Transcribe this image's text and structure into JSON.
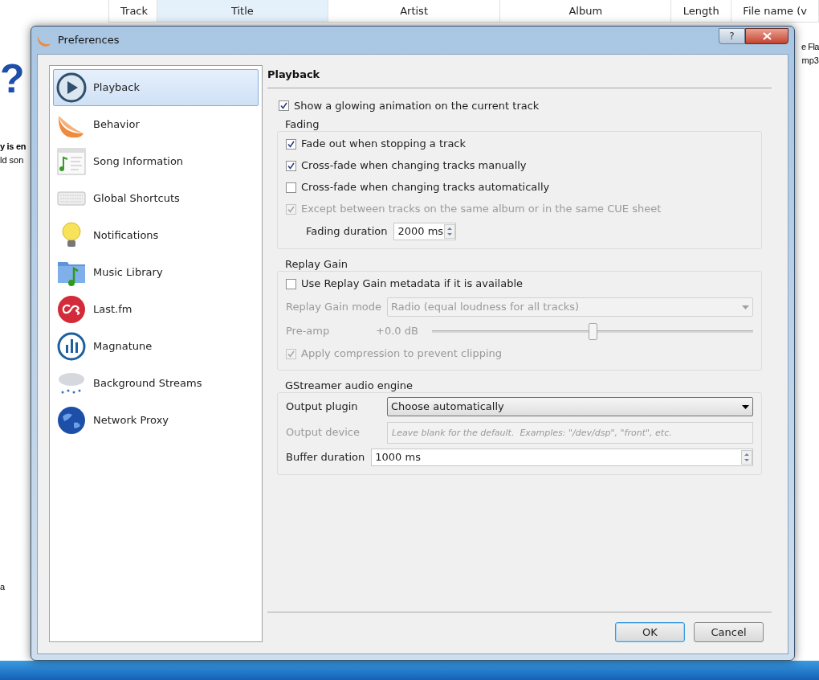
{
  "background_window": {
    "columns": [
      "Track",
      "Title",
      "Artist",
      "Album",
      "Length",
      "File name (v"
    ],
    "left_fragments": [
      "?",
      "y is en",
      "ld son",
      "a"
    ],
    "right_fragments": [
      "e Fla",
      "mp3"
    ]
  },
  "dialog": {
    "title": "Preferences",
    "help": "?",
    "sidebar": [
      {
        "label": "Playback",
        "selected": true
      },
      {
        "label": "Behavior",
        "selected": false
      },
      {
        "label": "Song Information",
        "selected": false
      },
      {
        "label": "Global Shortcuts",
        "selected": false
      },
      {
        "label": "Notifications",
        "selected": false
      },
      {
        "label": "Music Library",
        "selected": false
      },
      {
        "label": "Last.fm",
        "selected": false
      },
      {
        "label": "Magnatune",
        "selected": false
      },
      {
        "label": "Background Streams",
        "selected": false
      },
      {
        "label": "Network Proxy",
        "selected": false
      }
    ],
    "page_title": "Playback",
    "top_option": {
      "label": "Show a glowing animation on the current track",
      "checked": true,
      "disabled": false
    },
    "groups": [
      {
        "title": "Fading",
        "rows": [
          {
            "kind": "checkbox",
            "label": "Fade out when stopping a track",
            "checked": true,
            "disabled": false
          },
          {
            "kind": "checkbox",
            "label": "Cross-fade when changing tracks manually",
            "checked": true,
            "disabled": false
          },
          {
            "kind": "checkbox",
            "label": "Cross-fade when changing tracks automatically",
            "checked": false,
            "disabled": false
          },
          {
            "kind": "checkbox",
            "label": "Except between tracks on the same album or in the same CUE sheet",
            "checked": true,
            "disabled": true
          },
          {
            "kind": "spin",
            "label": "Fading duration",
            "value": "2000 ms",
            "disabled": false,
            "wide": false
          }
        ]
      },
      {
        "title": "Replay Gain",
        "rows": [
          {
            "kind": "checkbox",
            "label": "Use Replay Gain metadata if it is available",
            "checked": false,
            "disabled": false
          },
          {
            "kind": "select",
            "label": "Replay Gain mode",
            "value": "Radio (equal loudness for all tracks)",
            "disabled": true
          },
          {
            "kind": "slider",
            "label": "Pre-amp",
            "reading": "+0.0 dB",
            "level": 0.5,
            "disabled": true
          },
          {
            "kind": "checkbox",
            "label": "Apply compression to prevent clipping",
            "checked": true,
            "disabled": true
          }
        ]
      },
      {
        "title": "GStreamer audio engine",
        "rows": [
          {
            "kind": "select",
            "label": "Output plugin",
            "value": "Choose automatically",
            "disabled": false
          },
          {
            "kind": "text",
            "label": "Output device",
            "placeholder": "Leave blank for the default.  Examples: \"/dev/dsp\", \"front\", etc.",
            "disabled": true
          },
          {
            "kind": "spin",
            "label": "Buffer duration",
            "value": "1000 ms",
            "disabled": false,
            "wide": true
          }
        ]
      }
    ],
    "buttons": [
      {
        "label": "OK",
        "default": true
      },
      {
        "label": "Cancel",
        "default": false
      }
    ]
  }
}
